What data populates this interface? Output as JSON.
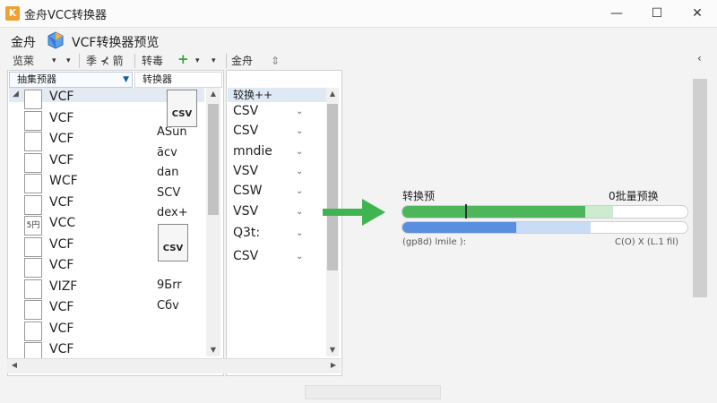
{
  "window": {
    "title": "金舟VCC转换器",
    "minimize": "—",
    "maximize": "☐",
    "close": "✕"
  },
  "header": {
    "brand": "金舟",
    "preview_title": "VCF转换器预览"
  },
  "toolbar": {
    "item1": "览萊",
    "item2": "季 ⊀ 箭",
    "item3": "转毒",
    "item3_plus": "+",
    "item4": "金舟",
    "item4_icon": "⇕"
  },
  "left_panel": {
    "source_select": "抽集预器",
    "target_label": "转换器",
    "vcf_rows": [
      "VCF",
      "VCF",
      "VCF",
      "VCF",
      "WCF",
      "VCF",
      "VCC",
      "VCF",
      "VCF",
      "VIZF",
      "VCF",
      "VCF",
      "VCF"
    ],
    "icon_labels": [
      "",
      "",
      "",
      "",
      "",
      "",
      "5円",
      "",
      "",
      "",
      "",
      "",
      ""
    ],
    "out_rows": [
      "ASun",
      "ācv",
      "dan",
      "SCV",
      "dex+",
      "",
      "9Бrr",
      "Cбv"
    ],
    "csv_doc_labels": [
      "CSV",
      "CSV",
      "CSV"
    ]
  },
  "mid_panel": {
    "header": "较换++",
    "formats": [
      "CSV",
      "CSV",
      "mndie",
      "VSV",
      "CSW",
      "VSV",
      "Q3t:",
      "CSV"
    ]
  },
  "progress": {
    "label": "转换预",
    "batch_label": "0批量预换",
    "percent": 22,
    "highlight_percent": 74,
    "secondary_percent": 40,
    "secondary_highlight_percent": 66,
    "speed": "(gp8d) lmile ):",
    "time": "C(O) X (L.1 fil)",
    "bar_color": "#4db65a",
    "bar2_color": "#5a8fe0"
  },
  "colors": {
    "accent_green": "#3aa53a",
    "selection_blue": "#dfe9f5"
  }
}
